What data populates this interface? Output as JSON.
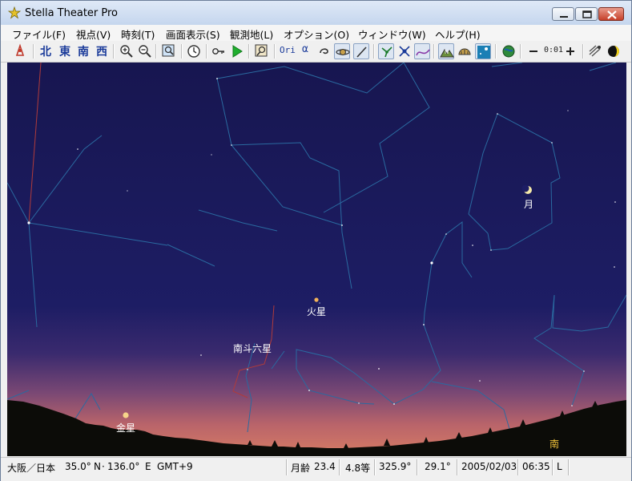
{
  "window": {
    "title": "Stella Theater Pro"
  },
  "menu": [
    "ファイル(F)",
    "視点(V)",
    "時刻(T)",
    "画面表示(S)",
    "観測地(L)",
    "オプション(O)",
    "ウィンドウ(W)",
    "ヘルプ(H)"
  ],
  "toolbar": {
    "directions": [
      "北",
      "東",
      "南",
      "西"
    ],
    "ori_label": "Ori",
    "alpha_label": "α",
    "zoom_value": "0:01",
    "icons": [
      "telescope-icon",
      "zoom-in-icon",
      "zoom-out-icon",
      "find-icon",
      "clock-icon",
      "key-icon",
      "play-icon",
      "search-object-icon",
      "swirl-icon",
      "planet-icon",
      "pen-icon",
      "constellation-icon",
      "satellite-icon",
      "path-icon",
      "terrain-icon",
      "dome-icon",
      "sky-icon",
      "globe-icon",
      "minus-icon",
      "plus-icon",
      "comet-icon",
      "moon-phase-icon"
    ]
  },
  "sky": {
    "labels": {
      "moon": "月",
      "mars": "火星",
      "nanto": "南斗六星",
      "venus": "金星",
      "south": "南"
    },
    "colors": {
      "sky_top": "#1a1a5e",
      "horizon_glow": "#c86a63",
      "constellation_line": "#2e6a9e",
      "ground": "#0c0c08"
    }
  },
  "status": {
    "location": "大阪／日本",
    "lat": "35.0°",
    "lat_dir": "N",
    "lon": "136.0°",
    "lon_dir": "E",
    "timezone": "GMT+9",
    "moon_age_label": "月齢",
    "moon_age": "23.4",
    "magnitude": "4.8等",
    "azimuth": "325.9°",
    "altitude": "29.1°",
    "date": "2005/02/03",
    "time": "06:35",
    "mode": "L"
  }
}
